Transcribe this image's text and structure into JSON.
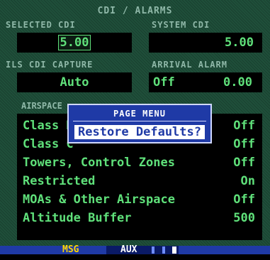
{
  "title": "CDI / ALARMS",
  "selected_cdi": {
    "label": "SELECTED CDI",
    "value": "5.00"
  },
  "system_cdi": {
    "label": "SYSTEM CDI",
    "value": "5.00"
  },
  "ils_cdi_capture": {
    "label": "ILS CDI CAPTURE",
    "value": "Auto"
  },
  "arrival_alarm": {
    "label": "ARRIVAL ALARM",
    "state": "Off",
    "value": "0.00"
  },
  "airspace": {
    "label": "AIRSPACE",
    "rows": [
      {
        "name": "Class B",
        "value": "Off"
      },
      {
        "name": "Class C",
        "value": "Off"
      },
      {
        "name": "Towers, Control Zones",
        "value": "Off"
      },
      {
        "name": "Restricted",
        "value": "On"
      },
      {
        "name": "MOAs & Other Airspace",
        "value": "Off"
      },
      {
        "name": "Altitude Buffer",
        "value": "500"
      }
    ]
  },
  "popup": {
    "title": "PAGE MENU",
    "item": "Restore Defaults?"
  },
  "status": {
    "msg": "MSG",
    "aux": "AUX",
    "page_count": 3,
    "active_page": 3
  },
  "colors": {
    "screen_bg": "#1f4f3a",
    "label": "#8fb8a8",
    "value": "#5fe07a",
    "popup_bg": "#1f3aa6",
    "msg": "#ffd800"
  }
}
